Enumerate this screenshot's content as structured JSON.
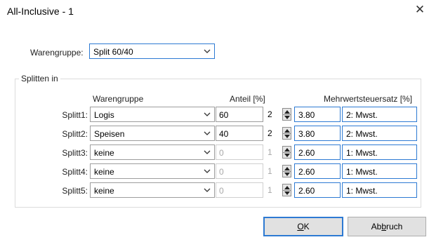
{
  "window": {
    "title": "All-Inclusive - 1"
  },
  "warengruppe": {
    "label": "Warengruppe:",
    "value": "Split 60/40"
  },
  "group": {
    "title": "Splitten in",
    "headers": {
      "warengruppe": "Warengruppe",
      "anteil": "Anteil [%]",
      "mwst": "Mehrwertsteuersatz [%]"
    },
    "rows": [
      {
        "label": "Splitt1:",
        "warengruppe": "Logis",
        "anteil": "60",
        "anteil_enabled": true,
        "spin": "2",
        "spin_enabled": true,
        "rate": "3.80",
        "code": "2: Mwst."
      },
      {
        "label": "Splitt2:",
        "warengruppe": "Speisen",
        "anteil": "40",
        "anteil_enabled": true,
        "spin": "2",
        "spin_enabled": true,
        "rate": "3.80",
        "code": "2: Mwst."
      },
      {
        "label": "Splitt3:",
        "warengruppe": "keine",
        "anteil": "0",
        "anteil_enabled": false,
        "spin": "1",
        "spin_enabled": false,
        "rate": "2.60",
        "code": "1: Mwst."
      },
      {
        "label": "Splitt4:",
        "warengruppe": "keine",
        "anteil": "0",
        "anteil_enabled": false,
        "spin": "1",
        "spin_enabled": false,
        "rate": "2.60",
        "code": "1: Mwst."
      },
      {
        "label": "Splitt5:",
        "warengruppe": "keine",
        "anteil": "0",
        "anteil_enabled": false,
        "spin": "1",
        "spin_enabled": false,
        "rate": "2.60",
        "code": "1: Mwst."
      }
    ]
  },
  "buttons": {
    "ok": {
      "mnemonic": "O",
      "rest": "K"
    },
    "cancel": {
      "prefix": "Ab",
      "mnemonic": "b",
      "rest": "ruch"
    }
  },
  "icons": {
    "close": "close-icon",
    "dropdown": "chevron-down-icon",
    "spinner": "spin-up-down-icon"
  },
  "colors": {
    "focus_border": "#2d7ad3",
    "button_face": "#e1e1e1",
    "disabled_text": "#a8a8a8"
  }
}
